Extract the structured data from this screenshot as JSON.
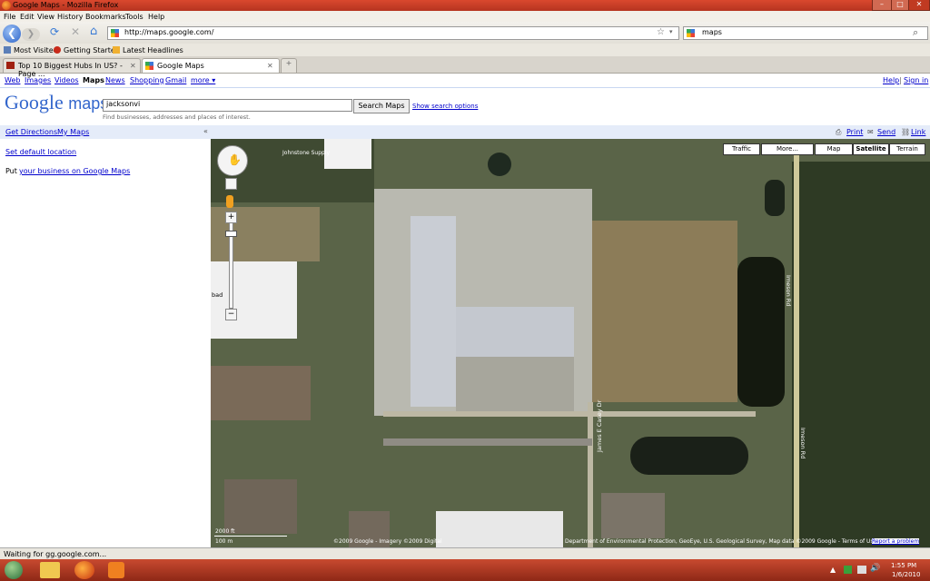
{
  "window": {
    "title": "Google Maps - Mozilla Firefox",
    "min": "–",
    "max": "□",
    "close": "✕"
  },
  "menu": [
    "File",
    "Edit",
    "View",
    "History",
    "Bookmarks",
    "Tools",
    "Help"
  ],
  "nav": {
    "back": "❮",
    "forward": "❯",
    "reload": "⟳",
    "stop": "✕",
    "home": "⌂",
    "url": "http://maps.google.com/",
    "star": "☆",
    "search_engine_query": "maps",
    "search_icon": "⌕"
  },
  "bookmarks": [
    "Most Visited",
    "Getting Started",
    "Latest Headlines"
  ],
  "tabs": [
    {
      "label": "Top 10 Biggest Hubs In US? - Page ..."
    },
    {
      "label": "Google Maps"
    }
  ],
  "tab_close": "✕",
  "new_tab": "+",
  "google_bar": {
    "links": [
      "Web",
      "Images",
      "Videos",
      "Maps",
      "News",
      "Shopping",
      "Gmail",
      "more ▾"
    ],
    "help": "Help",
    "sep": "|",
    "signin": "Sign in"
  },
  "search": {
    "logo_google": "Google",
    "logo_maps": "maps",
    "query": "jacksonvi",
    "button": "Search Maps",
    "options": "Show search options",
    "hint": "Find businesses, addresses and places of interest."
  },
  "panel": {
    "get_directions": "Get Directions",
    "my_maps": "My Maps",
    "collapse": "«",
    "print": "Print",
    "send": "Send",
    "link": "Link"
  },
  "left": {
    "default_location": "Set default location",
    "put": "Put ",
    "business_link": "your business on Google Maps"
  },
  "map": {
    "buttons": [
      "Traffic",
      "More...",
      "Map",
      "Satellite",
      "Terrain"
    ],
    "labels": {
      "johnstone": "Johnstone Supply",
      "imeson1": "Imeson Rd",
      "imeson2": "Imeson Rd",
      "james": "James E Casey Dr",
      "bad": "bad"
    },
    "scale_ft": "2000 ft",
    "scale_m": "100 m",
    "copyright": "©2009 Google - Imagery ©2009 Digital",
    "copyright2": "Department of Environmental Protection, GeoEye, U.S. Geological Survey, Map data ©2009 Google - Terms of Use",
    "report": "Report a problem"
  },
  "status": "Waiting for gg.google.com...",
  "taskbar": {
    "time": "1:55 PM",
    "date": "1/6/2010"
  }
}
